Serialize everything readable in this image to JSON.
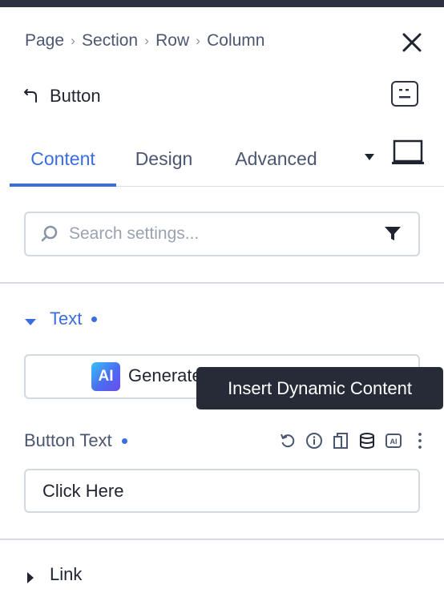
{
  "breadcrumb": {
    "items": [
      "Page",
      "Section",
      "Row",
      "Column"
    ],
    "separator": "›"
  },
  "panel": {
    "title": "Button"
  },
  "tabs": [
    {
      "label": "Content",
      "active": true
    },
    {
      "label": "Design",
      "active": false
    },
    {
      "label": "Advanced",
      "active": false
    }
  ],
  "search": {
    "placeholder": "Search settings...",
    "value": ""
  },
  "section_text": {
    "title": "Text"
  },
  "ai_button": {
    "logo": "AI",
    "label": "Generate"
  },
  "tooltip": {
    "text": "Insert Dynamic Content"
  },
  "button_text_field": {
    "label": "Button Text",
    "value": "Click Here",
    "icons": [
      "reset-icon",
      "info-icon",
      "copy-icon",
      "dynamic-content-icon",
      "ai-icon",
      "more-icon"
    ]
  },
  "section_link": {
    "title": "Link"
  },
  "colors": {
    "accent": "#3b6de0",
    "text": "#1f2430",
    "muted": "#4b5670",
    "border": "#d4d8e0",
    "tooltip_bg": "#262b37",
    "topbar": "#2d3142"
  }
}
